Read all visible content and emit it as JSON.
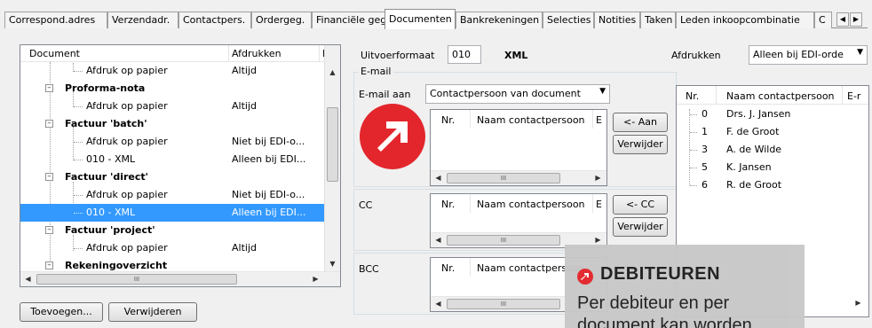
{
  "tabs": [
    "Correspond.adres",
    "Verzendadr.",
    "Contactpers.",
    "Ordergeg.",
    "Financiële geg.",
    "Documenten",
    "Bankrekeningen",
    "Selecties",
    "Notities",
    "Taken",
    "Leden inkoopcombinatie",
    "C"
  ],
  "tree": {
    "columns": [
      "Document",
      "Afdrukken",
      "La"
    ],
    "rows": [
      {
        "doc": "Afdruk op papier",
        "print": "Altijd"
      },
      {
        "doc": "Proforma-nota",
        "print": ""
      },
      {
        "doc": "Afdruk op papier",
        "print": "Altijd"
      },
      {
        "doc": "Factuur 'batch'",
        "print": ""
      },
      {
        "doc": "Afdruk op papier",
        "print": "Niet bij EDI-o..."
      },
      {
        "doc": "010 - XML",
        "print": "Alleen bij EDI..."
      },
      {
        "doc": "Factuur 'direct'",
        "print": ""
      },
      {
        "doc": "Afdruk op papier",
        "print": "Niet bij EDI-o..."
      },
      {
        "doc": "010 - XML",
        "print": "Alleen bij EDI..."
      },
      {
        "doc": "Factuur 'project'",
        "print": ""
      },
      {
        "doc": "Afdruk op papier",
        "print": "Altijd"
      },
      {
        "doc": "Rekeningoverzicht",
        "print": ""
      }
    ],
    "hscroll_thumb": "III"
  },
  "buttons": {
    "add": "Toevoegen...",
    "remove": "Verwijderen",
    "to_aan": "<- Aan",
    "remove_aan": "Verwijder",
    "to_cc": "<- CC",
    "remove_cc": "Verwijder"
  },
  "form": {
    "uitvoerformaat_label": "Uitvoerformaat",
    "uitvoerformaat_code": "010",
    "uitvoerformaat_name": "XML",
    "afdrukken_label": "Afdrukken",
    "afdrukken_value": "Alleen bij EDI-orde",
    "email_group": "E-mail",
    "email_aan_label": "E-mail aan",
    "email_aan_value": "Contactpersoon van document",
    "cc_label": "CC",
    "bcc_label": "BCC"
  },
  "mini_columns": [
    "Nr.",
    "Naam contactpersoon",
    "E"
  ],
  "contacts": {
    "columns": [
      "Nr.",
      "Naam contactpersoon",
      "E-r"
    ],
    "rows": [
      {
        "nr": "0",
        "name": "Drs. J. Jansen"
      },
      {
        "nr": "1",
        "name": "F. de Groot"
      },
      {
        "nr": "3",
        "name": "A. de Wilde"
      },
      {
        "nr": "5",
        "name": "K. Jansen"
      },
      {
        "nr": "6",
        "name": "R. de Groot"
      }
    ]
  },
  "callout": {
    "title": "DEBITEUREN",
    "body": "Per debiteur en per document kan worden"
  },
  "colors": {
    "accent": "#e3262c",
    "selection": "#3399ff"
  }
}
